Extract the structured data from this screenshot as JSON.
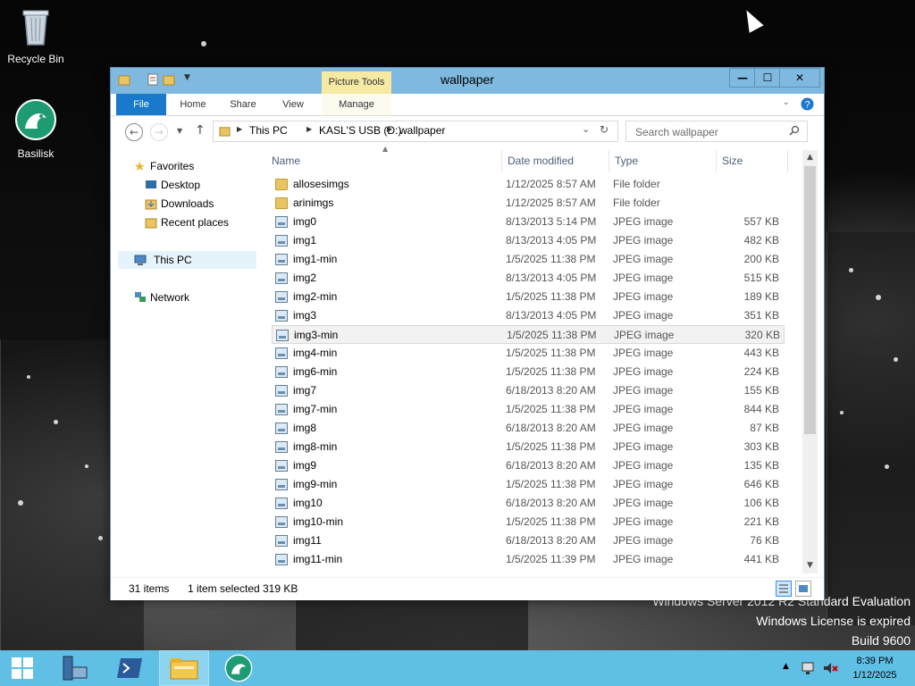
{
  "desktop": {
    "icons": [
      {
        "label": "Recycle Bin",
        "icon": "recycle-bin-icon"
      },
      {
        "label": "Basilisk",
        "icon": "basilisk-icon"
      }
    ],
    "watermark": {
      "line1": "Windows Server 2012 R2 Standard Evaluation",
      "line2": "Windows License is expired",
      "line3": "Build 9600"
    }
  },
  "window": {
    "title": "wallpaper",
    "contextual_tab_group": "Picture Tools",
    "tabs": [
      {
        "label": "File"
      },
      {
        "label": "Home"
      },
      {
        "label": "Share"
      },
      {
        "label": "View"
      },
      {
        "label": "Manage"
      }
    ],
    "controls": {
      "minimize": "—",
      "maximize": "☐",
      "close": "✕"
    },
    "address": {
      "crumbs": [
        "This PC",
        "KASL'S USB (D:)",
        "wallpaper"
      ]
    },
    "search": {
      "placeholder": "Search wallpaper"
    },
    "nav_pane": {
      "favorites": "Favorites",
      "desktop": "Desktop",
      "downloads": "Downloads",
      "recent": "Recent places",
      "this_pc": "This PC",
      "network": "Network"
    },
    "columns": [
      "Name",
      "Date modified",
      "Type",
      "Size"
    ],
    "files": [
      {
        "name": "allosesimgs",
        "date": "1/12/2025 8:57 AM",
        "type": "File folder",
        "size": "",
        "kind": "folder"
      },
      {
        "name": "arinimgs",
        "date": "1/12/2025 8:57 AM",
        "type": "File folder",
        "size": "",
        "kind": "folder"
      },
      {
        "name": "img0",
        "date": "8/13/2013 5:14 PM",
        "type": "JPEG image",
        "size": "557 KB",
        "kind": "jpeg"
      },
      {
        "name": "img1",
        "date": "8/13/2013 4:05 PM",
        "type": "JPEG image",
        "size": "482 KB",
        "kind": "jpeg"
      },
      {
        "name": "img1-min",
        "date": "1/5/2025 11:38 PM",
        "type": "JPEG image",
        "size": "200 KB",
        "kind": "jpeg"
      },
      {
        "name": "img2",
        "date": "8/13/2013 4:05 PM",
        "type": "JPEG image",
        "size": "515 KB",
        "kind": "jpeg"
      },
      {
        "name": "img2-min",
        "date": "1/5/2025 11:38 PM",
        "type": "JPEG image",
        "size": "189 KB",
        "kind": "jpeg"
      },
      {
        "name": "img3",
        "date": "8/13/2013 4:05 PM",
        "type": "JPEG image",
        "size": "351 KB",
        "kind": "jpeg"
      },
      {
        "name": "img3-min",
        "date": "1/5/2025 11:38 PM",
        "type": "JPEG image",
        "size": "320 KB",
        "kind": "jpeg",
        "selected": true
      },
      {
        "name": "img4-min",
        "date": "1/5/2025 11:38 PM",
        "type": "JPEG image",
        "size": "443 KB",
        "kind": "jpeg"
      },
      {
        "name": "img6-min",
        "date": "1/5/2025 11:38 PM",
        "type": "JPEG image",
        "size": "224 KB",
        "kind": "jpeg"
      },
      {
        "name": "img7",
        "date": "6/18/2013 8:20 AM",
        "type": "JPEG image",
        "size": "155 KB",
        "kind": "jpeg"
      },
      {
        "name": "img7-min",
        "date": "1/5/2025 11:38 PM",
        "type": "JPEG image",
        "size": "844 KB",
        "kind": "jpeg"
      },
      {
        "name": "img8",
        "date": "6/18/2013 8:20 AM",
        "type": "JPEG image",
        "size": "87 KB",
        "kind": "jpeg"
      },
      {
        "name": "img8-min",
        "date": "1/5/2025 11:38 PM",
        "type": "JPEG image",
        "size": "303 KB",
        "kind": "jpeg"
      },
      {
        "name": "img9",
        "date": "6/18/2013 8:20 AM",
        "type": "JPEG image",
        "size": "135 KB",
        "kind": "jpeg"
      },
      {
        "name": "img9-min",
        "date": "1/5/2025 11:38 PM",
        "type": "JPEG image",
        "size": "646 KB",
        "kind": "jpeg"
      },
      {
        "name": "img10",
        "date": "6/18/2013 8:20 AM",
        "type": "JPEG image",
        "size": "106 KB",
        "kind": "jpeg"
      },
      {
        "name": "img10-min",
        "date": "1/5/2025 11:38 PM",
        "type": "JPEG image",
        "size": "221 KB",
        "kind": "jpeg"
      },
      {
        "name": "img11",
        "date": "6/18/2013 8:20 AM",
        "type": "JPEG image",
        "size": "76 KB",
        "kind": "jpeg"
      },
      {
        "name": "img11-min",
        "date": "1/5/2025 11:39 PM",
        "type": "JPEG image",
        "size": "441 KB",
        "kind": "jpeg"
      }
    ],
    "status": {
      "item_count": "31 items",
      "selection": "1 item selected",
      "selection_size": "319 KB"
    }
  },
  "taskbar": {
    "clock_time": "8:39 PM",
    "clock_date": "1/12/2025"
  },
  "colors": {
    "accent": "#1979ca",
    "window_frame": "#7fb9df",
    "taskbar": "#5fbfe5",
    "picture_tools": "#f6eaa3"
  }
}
